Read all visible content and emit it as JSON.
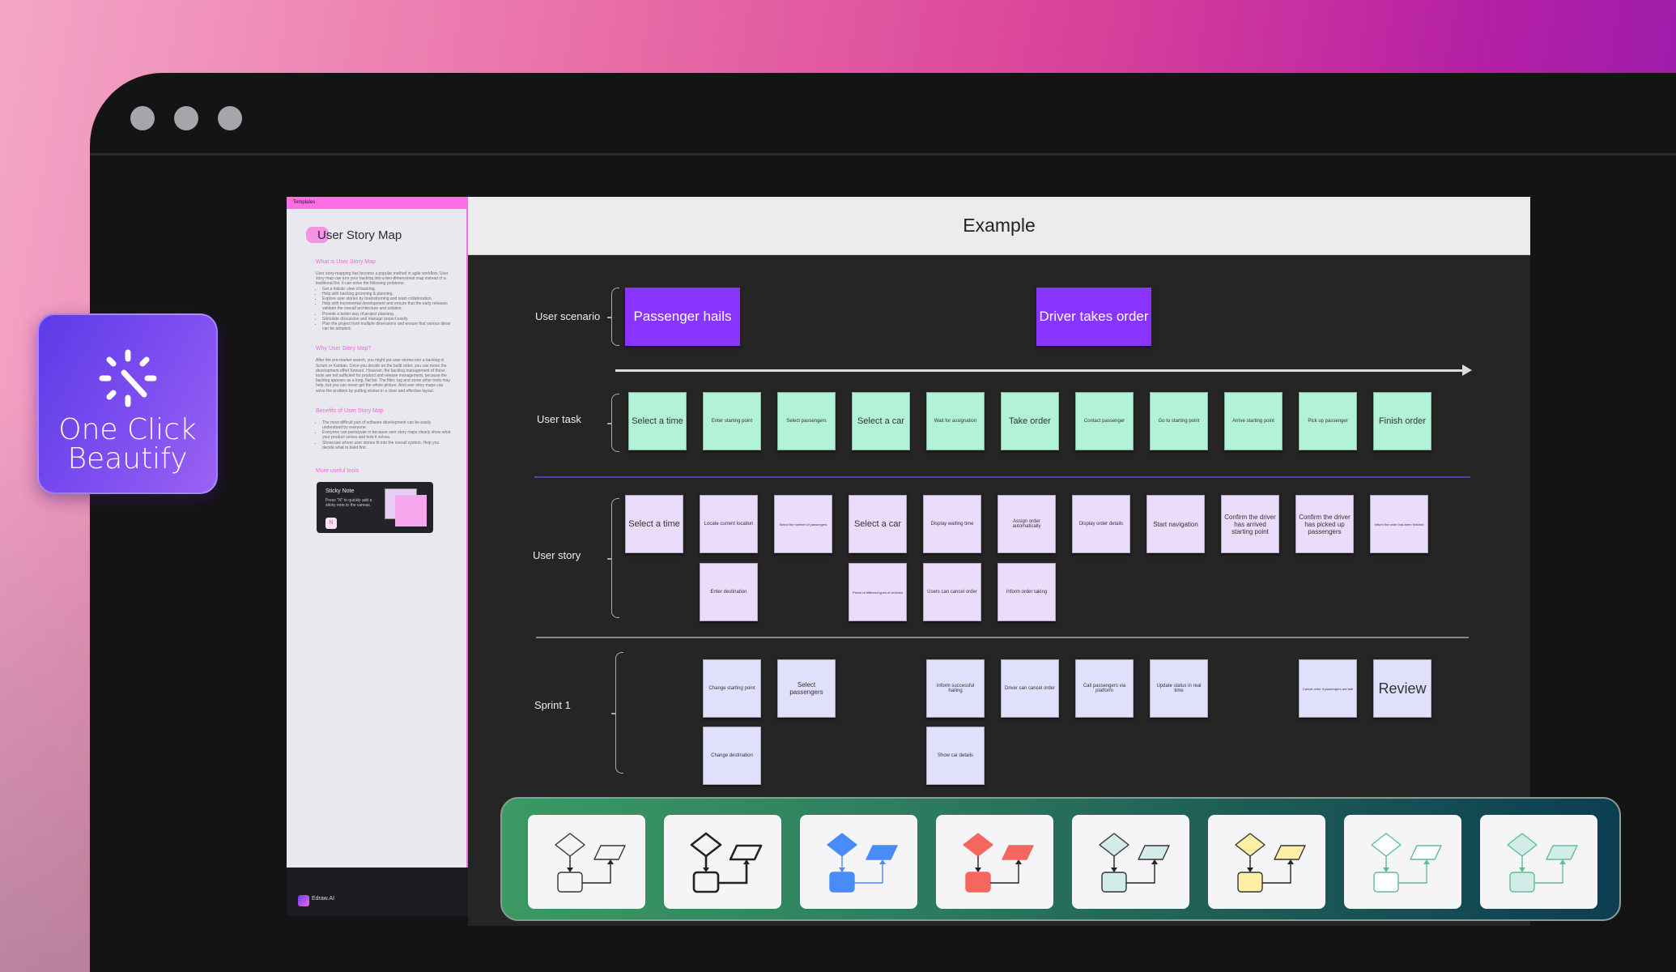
{
  "badge": {
    "label_line1": "One Click",
    "label_line2": "Beautify",
    "icon": "sparkle-wand-icon"
  },
  "window": {
    "controls": [
      "window-dot",
      "window-dot",
      "window-dot"
    ]
  },
  "template_panel": {
    "header": "Templates",
    "title": "User Story Map",
    "sections": [
      {
        "heading": "What is User Story Map",
        "text": "User story mapping has become a popular method in agile workflow. User story map can turn your backlog into a two-dimensional map instead of a traditional list. It can solve the following problems:",
        "bullets": [
          "Get a holistic view of backlog.",
          "Help with backlog grooming & planning.",
          "Explore user stories by brainstorming and team collaboration.",
          "Help with incremental development and ensure that the early releases validate the overall architecture and solution.",
          "Provide a better way of project planning.",
          "Stimulate discussion and manage project easily.",
          "Plan the project from multiple dimensions and ensure that various ideas can be adopted."
        ]
      },
      {
        "heading": "Why User Story Map?",
        "text": "After the pre-market search, you might put user stories into a backlog in Scrum or Kanban. Once you decide on the build order, you can move the development effort forward. However, the backlog management of these tools are not sufficient for product and release management, because the backlog appears as a long, flat list. The filter, tag and some other tools may help, but you can never get the whole picture. And user story maps can solve the problem by putting stories in a clear and effective layout.",
        "bullets": []
      },
      {
        "heading": "Benefits of User Story Map",
        "text": "",
        "bullets": [
          "The most difficult part of software development can be easily understood by everyone.",
          "Everyone can participate in because user story maps clearly show what your product solves and how it solves.",
          "Showcase where user stories fit into the overall system. Help you decide what to build first."
        ]
      }
    ],
    "tools_heading": "More useful tools",
    "sticky_card": {
      "title": "Sticky Note",
      "description": "Press \"N\" to quickly add a sticky note to the canvas.",
      "shortcut": "N"
    },
    "footer_brand": "Edraw.AI"
  },
  "canvas": {
    "title": "Example",
    "rows": {
      "scenario": "User scenario",
      "task": "User task",
      "story": "User story",
      "sprint": "Sprint 1"
    },
    "scenarios": [
      "Passenger hails",
      "Driver takes order"
    ],
    "tasks": [
      "Select a time",
      "Enter starting point",
      "Select passengers",
      "Select a car",
      "Wait for assignation",
      "Take order",
      "Contact passenger",
      "Go to starting point",
      "Arrive starting point",
      "Pick up passenger",
      "Finish order"
    ],
    "stories_row1": [
      "Select a time",
      "Locate current location",
      "Select the number of passengers",
      "Select a car",
      "Display waiting time",
      "Assign order automatically",
      "Display order details",
      "Start navigation",
      "Confirm the driver has arrived starting point",
      "Confirm the driver has picked up passengers",
      "Inform the order has been finished"
    ],
    "stories_row2": [
      "Enter destination",
      "Prices of different types of vehicles",
      "Users can cancel order",
      "Inform order taking"
    ],
    "sprint_row1": [
      "Change starting point",
      "Select passengers",
      "Inform successful hailing",
      "Driver can cancel order",
      "Call passengers via platform",
      "Update status in real time",
      "Cancel order if passengers are late",
      "Review"
    ],
    "sprint_row2": [
      "Change destination",
      "Show car details"
    ]
  },
  "themes": [
    {
      "name": "theme-outline-thin",
      "fill": "none",
      "stroke": "#333333"
    },
    {
      "name": "theme-outline-bold",
      "fill": "none",
      "stroke": "#222222"
    },
    {
      "name": "theme-blue",
      "fill": "#4a8cf7",
      "stroke": "#4a8cf7"
    },
    {
      "name": "theme-red",
      "fill": "#f4665e",
      "stroke": "#f4665e"
    },
    {
      "name": "theme-mint",
      "fill": "#d2ece8",
      "stroke": "#333333"
    },
    {
      "name": "theme-yellow",
      "fill": "#fdf0a6",
      "stroke": "#333333"
    },
    {
      "name": "theme-green-outline",
      "fill": "#ffffff",
      "stroke": "#5fbf94"
    },
    {
      "name": "theme-pale-mint",
      "fill": "#d2ece8",
      "stroke": "#5fbf94"
    }
  ],
  "colors": {
    "scenario": "#8a34ff",
    "task": "#b2f2d6",
    "story": "#ecdcfb",
    "sprint": "#e0e0fc",
    "panel_accent": "#ff6ee6"
  }
}
